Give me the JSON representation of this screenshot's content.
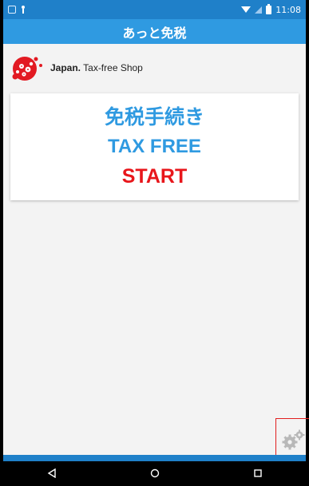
{
  "status_bar": {
    "time": "11:08"
  },
  "app_bar": {
    "title": "あっと免税"
  },
  "brand": {
    "bold_text": "Japan.",
    "text": "Tax-free Shop"
  },
  "start_card": {
    "line1": "免税手続き",
    "line2": "TAX FREE",
    "line3": "START"
  },
  "icons": {
    "settings": "gears-icon",
    "nav_back": "back-triangle-icon",
    "nav_home": "home-circle-icon",
    "nav_recent": "recent-square-icon"
  },
  "colors": {
    "status_bar": "#1f80c9",
    "app_bar": "#2f9ae1",
    "accent_blue": "#2f9ae1",
    "start_red": "#e8161b",
    "highlight_border": "#e11e1e"
  }
}
